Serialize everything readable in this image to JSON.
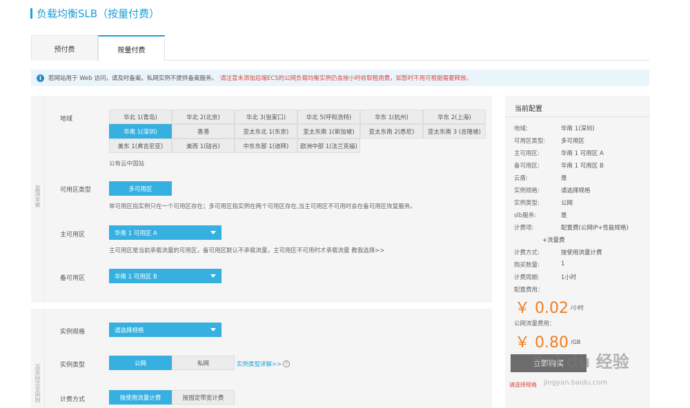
{
  "header": {
    "title": "负载均衡SLB（按量付费）"
  },
  "tabs": [
    {
      "label": "预付费"
    },
    {
      "label": "按量付费"
    }
  ],
  "notice": {
    "text1": "若网站用于 Web 访问，请及时备案。私网实例不提供备案服务。",
    "text2": "请注意未添加后端ECS的公网负载均衡实例仍会按小时收取租用费，如暂时不用可根据需要释放。"
  },
  "block1": {
    "side_label": "基本配置",
    "region": {
      "label": "地域",
      "rows": [
        [
          "华北 1(青岛)",
          "华北 2(北京)",
          "华北 3(张家口)",
          "华北 5(呼和浩特)",
          "华东 1(杭州)",
          "华东 2(上海)"
        ],
        [
          "华南 1(深圳)",
          "香港",
          "亚太东北 1(东京)",
          "亚太东南 1(新加坡)",
          "亚太东南 2(悉尼)",
          "亚太东南 3 (吉隆坡)"
        ],
        [
          "美东 1(弗吉尼亚)",
          "美西 1(硅谷)",
          "中东东部 1(迪拜)",
          "欧洲中部 1(法兰克福)"
        ]
      ],
      "footnote": "公有云中国站"
    },
    "zone_type": {
      "label": "可用区类型",
      "value": "多可用区",
      "hint": "单可用区指实例只在一个可用区存在；多可用区指实例在两个可用区存在,当主可用区不可用时会在备可用区恢复服务。"
    },
    "primary_zone": {
      "label": "主可用区",
      "value": "华南 1 可用区 A",
      "hint": "主可用区是当前承载流量的可用区，备可用区默认不承载流量，主可用区不可用时才承载流量 教我选择>>"
    },
    "backup_zone": {
      "label": "备可用区",
      "value": "华南 1 可用区 B"
    }
  },
  "block2": {
    "side_label": "网络及实例类型",
    "spec": {
      "label": "实例规格",
      "value": "请选择规格"
    },
    "instance_type": {
      "label": "实例类型",
      "options": [
        "公网",
        "私网"
      ],
      "detail_link": "实例类型详解>>"
    },
    "billing": {
      "label": "计费方式",
      "options": [
        "按使用流量计费",
        "按固定带宽计费"
      ]
    }
  },
  "panel": {
    "title": "当前配置",
    "rows": [
      {
        "k": "地域:",
        "v": "华南 1(深圳)"
      },
      {
        "k": "可用区类型:",
        "v": "多可用区"
      },
      {
        "k": "主可用区:",
        "v": "华南 1 可用区 A"
      },
      {
        "k": "备可用区:",
        "v": "华南 1 可用区 B"
      },
      {
        "k": "云盾:",
        "v": "是"
      },
      {
        "k": "实例规格:",
        "v": "请选择规格"
      },
      {
        "k": "实例类型:",
        "v": "公网"
      },
      {
        "k": "slb服务:",
        "v": "是"
      },
      {
        "k": "计费项:",
        "v": "配置费(公网IP+性能规格)"
      }
    ],
    "extra_item": "+流量费",
    "rows2": [
      {
        "k": "计费方式:",
        "v": "按使用流量计费"
      },
      {
        "k": "购买数量:",
        "v": "1"
      },
      {
        "k": "计费周期:",
        "v": "1小时"
      }
    ],
    "config_fee_label": "配置费用：",
    "config_fee": "￥ 0.02",
    "config_fee_unit": "/小时",
    "traffic_fee_label": "公网流量费用：",
    "traffic_fee": "￥ 0.80",
    "traffic_fee_unit": "/GB",
    "buy_label": "立即购买",
    "warning": "请选择规格"
  },
  "watermark": {
    "brand": "Bai du 经验",
    "url": "jingyan.baidu.com"
  }
}
